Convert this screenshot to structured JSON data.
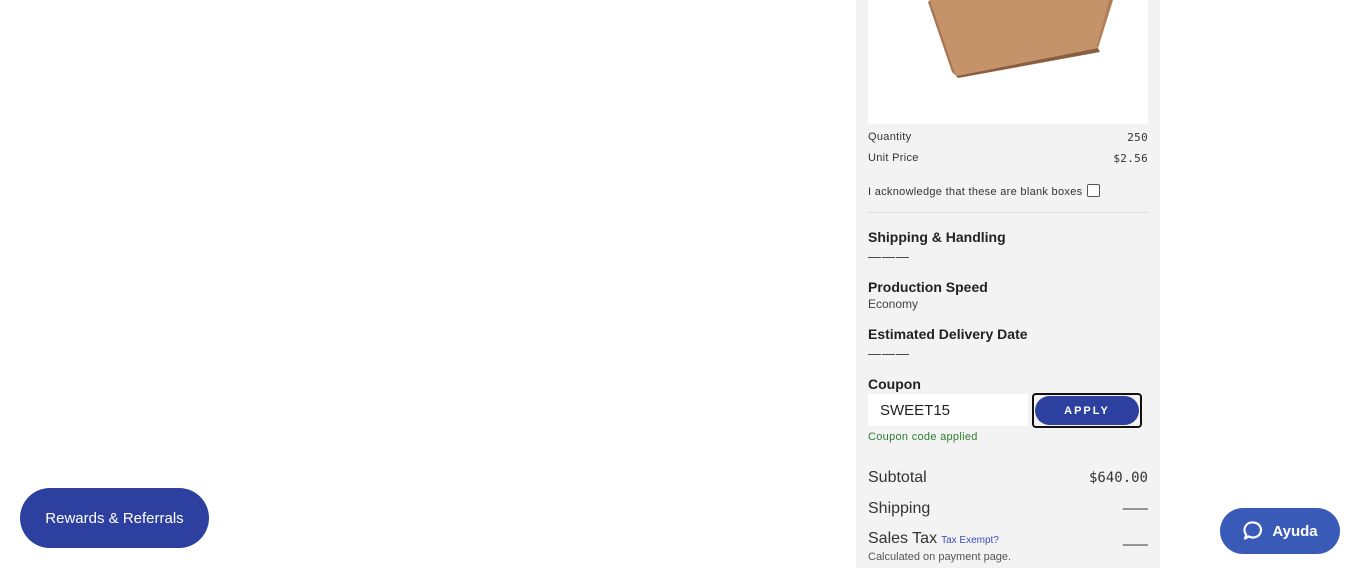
{
  "order_summary": {
    "quantity_label": "Quantity",
    "quantity_value": "250",
    "unit_price_label": "Unit Price",
    "unit_price_value": "$2.56",
    "acknowledge_label": "I acknowledge that these are blank boxes",
    "acknowledge_checked": false,
    "shipping_handling_title": "Shipping & Handling",
    "shipping_handling_value": "———",
    "production_speed_title": "Production Speed",
    "production_speed_value": "Economy",
    "estimated_delivery_title": "Estimated Delivery Date",
    "estimated_delivery_value": "———"
  },
  "coupon": {
    "title": "Coupon",
    "input_value": "SWEET15",
    "apply_label": "APPLY",
    "status_message": "Coupon code applied"
  },
  "totals": {
    "subtotal_label": "Subtotal",
    "subtotal_value": "$640.00",
    "shipping_label": "Shipping",
    "shipping_value": "———",
    "sales_tax_label": "Sales Tax",
    "tax_exempt_link": "Tax Exempt?",
    "sales_tax_value": "———",
    "tax_note": "Calculated on payment page."
  },
  "floating": {
    "rewards_label": "Rewards & Referrals",
    "help_label": "Ayuda",
    "help_icon": "chat-bubble-icon"
  },
  "colors": {
    "accent": "#2d40a0",
    "help_button": "#3a5ab8",
    "success": "#2e7d32",
    "panel_bg": "#f3f3f3"
  }
}
